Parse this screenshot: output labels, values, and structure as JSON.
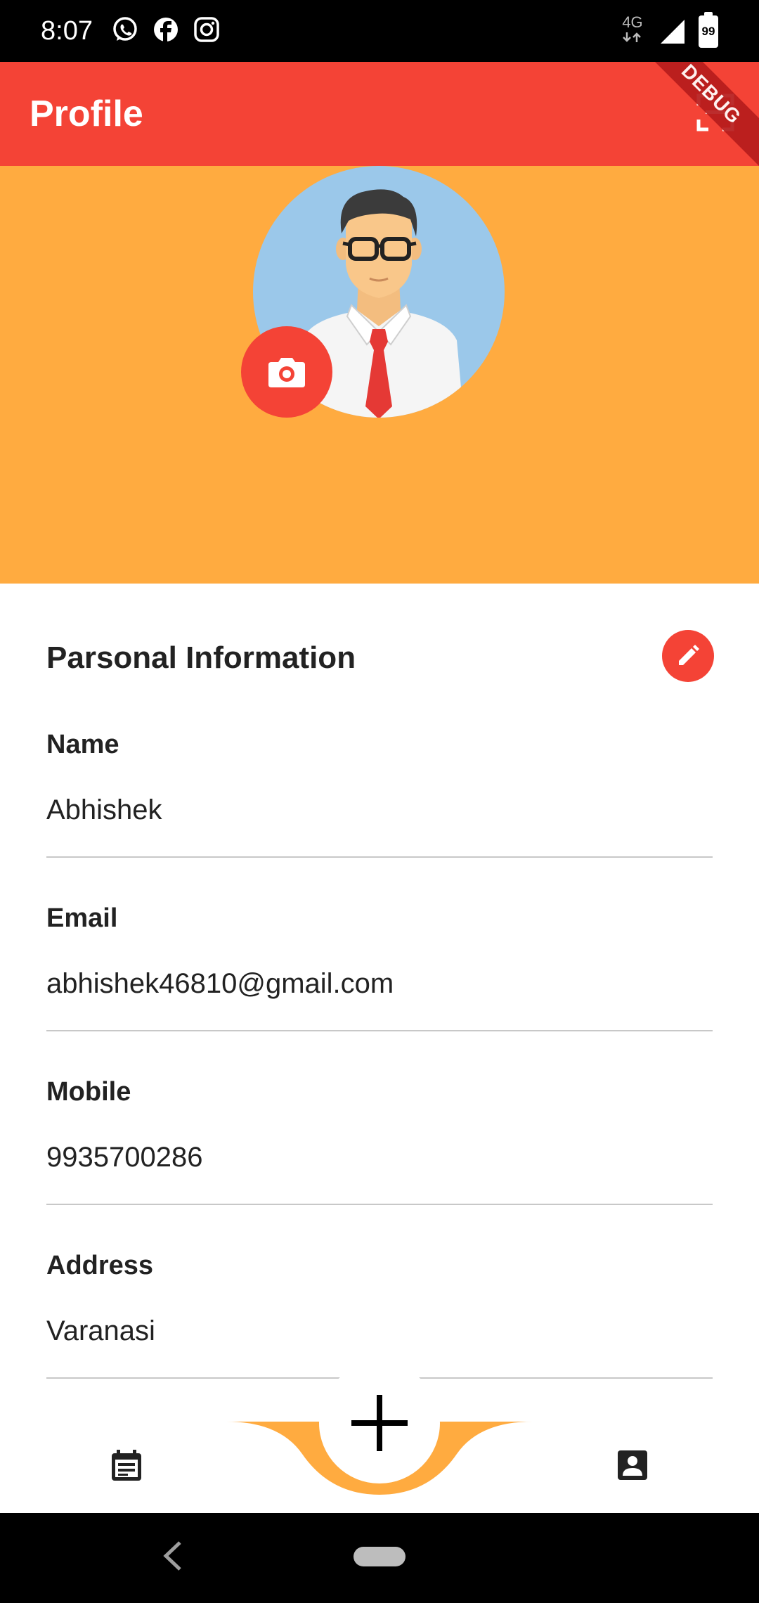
{
  "status_bar": {
    "time": "8:07",
    "app_icons": [
      "whatsapp-icon",
      "facebook-icon",
      "instagram-icon"
    ],
    "network_label": "4G",
    "battery_level": "99"
  },
  "app_bar": {
    "title": "Profile",
    "debug_label": "DEBUG",
    "color": "#f44336"
  },
  "hero": {
    "background_color": "#ffab40",
    "avatar_icon": "person-avatar",
    "camera_icon": "camera-icon"
  },
  "personal_info": {
    "section_title": "Parsonal Information",
    "edit_icon": "pencil-icon",
    "fields": [
      {
        "label": "Name",
        "value": "Abhishek"
      },
      {
        "label": "Email",
        "value": "abhishek46810@gmail.com"
      },
      {
        "label": "Mobile",
        "value": "9935700286"
      },
      {
        "label": "Address",
        "value": "Varanasi"
      }
    ]
  },
  "bottom_nav": {
    "left_icon": "calendar-icon",
    "center_icon": "plus-icon",
    "right_icon": "contact-icon",
    "accent_color": "#ffab40"
  },
  "system_nav": {
    "back_icon": "back-icon",
    "home_icon": "home-pill"
  }
}
